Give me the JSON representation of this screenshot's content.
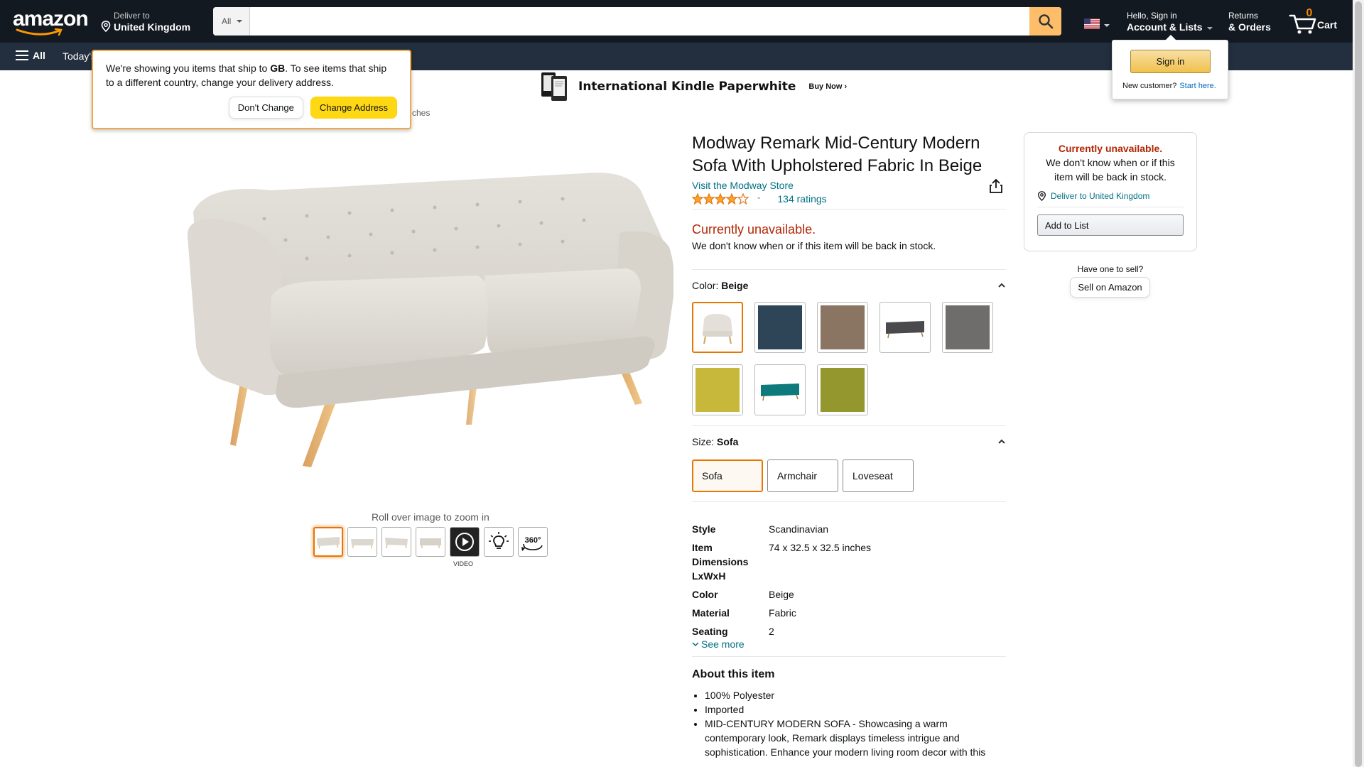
{
  "nav": {
    "logo": "amazon",
    "deliver_line1": "Deliver to",
    "deliver_line2": "United Kingdom",
    "search_category": "All",
    "search_placeholder": "",
    "account_line1": "Hello, Sign in",
    "account_line2": "Account & Lists",
    "returns_line1": "Returns",
    "returns_line2": "& Orders",
    "cart_count": "0",
    "cart_label": "Cart",
    "all_label": "All",
    "today_label": "Today's"
  },
  "address_popover": {
    "text_before": "We're showing you items that ship to ",
    "country": "GB",
    "text_after": ". To see items that ship to a different country, change your delivery address.",
    "dont_change": "Don't Change",
    "change_address": "Change Address",
    "obscured_text": "ches"
  },
  "signin_popover": {
    "button": "Sign in",
    "new_customer": "New customer?",
    "start_here": "Start here."
  },
  "banner": {
    "title": "International Kindle Paperwhite",
    "cta": "Buy Now ›"
  },
  "gallery": {
    "zoom_hint": "Roll over image to zoom in",
    "video_label": "VIDEO"
  },
  "product": {
    "title": "Modway Remark Mid-Century Modern Sofa With Upholstered Fabric In Beige",
    "store_link": "Visit the Modway Store",
    "rating_stars": 4,
    "ratings_count": "134 ratings",
    "availability": "Currently unavailable.",
    "availability_sub": "We don't know when or if this item will be back in stock.",
    "color_label": "Color:",
    "color_value": "Beige",
    "size_label": "Size:",
    "size_value": "Sofa",
    "sizes": [
      "Sofa",
      "Armchair",
      "Loveseat"
    ],
    "specs": [
      {
        "k": "Style",
        "v": "Scandinavian"
      },
      {
        "k": "Item Dimensions LxWxH",
        "v": "74 x 32.5 x 32.5 inches"
      },
      {
        "k": "Color",
        "v": "Beige"
      },
      {
        "k": "Material",
        "v": "Fabric"
      },
      {
        "k": "Seating Capacity",
        "v": "2"
      }
    ],
    "see_more": "See more",
    "about_title": "About this item",
    "bullets": [
      "100% Polyester",
      "Imported",
      "MID-CENTURY MODERN SOFA - Showcasing a warm contemporary look, Remark displays timeless intrigue and sophistication. Enhance your modern living room decor with this"
    ]
  },
  "buybox": {
    "unavailable": "Currently unavailable.",
    "sub": "We don't know when or if this item will be back in stock.",
    "deliver": "Deliver to United Kingdom",
    "add_to_list": "Add to List",
    "have_one": "Have one to sell?",
    "sell": "Sell on Amazon"
  },
  "colors": {
    "nav_bg": "#131921",
    "nav2_bg": "#232f3e",
    "accent": "#f08804",
    "search_btn": "#febd69",
    "unavailable": "#b12704",
    "link": "#007185"
  }
}
